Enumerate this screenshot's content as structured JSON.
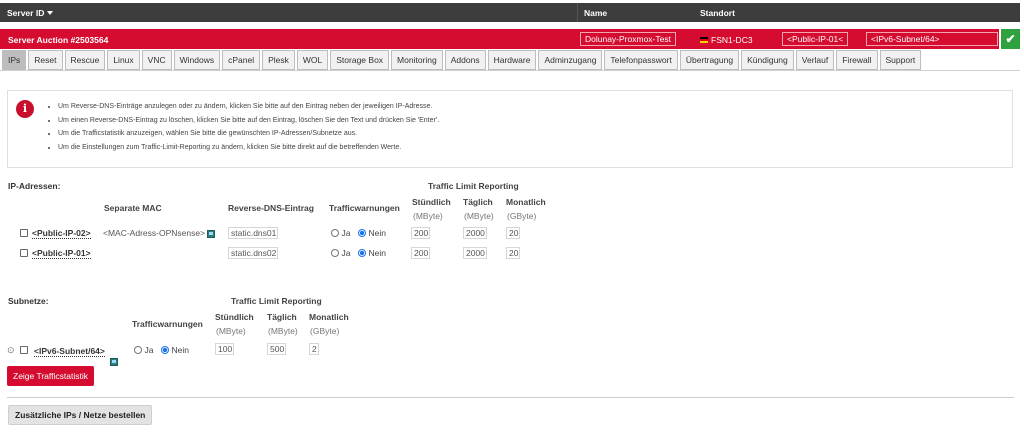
{
  "header": {
    "server_id": "Server ID",
    "name": "Name",
    "standort": "Standort"
  },
  "server": {
    "title": "Server Auction #2503564",
    "name": "Dolunay-Proxmox-Test",
    "location": "FSN1-DC3",
    "public_ip": "<Public-IP-01<",
    "ipv6_subnet": "<IPv6-Subnet/64>",
    "status_icon": "check-icon",
    "flag_icon": "german-flag-icon"
  },
  "tabs": [
    "IPs",
    "Reset",
    "Rescue",
    "Linux",
    "VNC",
    "Windows",
    "cPanel",
    "Plesk",
    "WOL",
    "Storage Box",
    "Monitoring",
    "Addons",
    "Hardware",
    "Adminzugang",
    "Telefonpasswort",
    "Übertragung",
    "Kündigung",
    "Verlauf",
    "Firewall",
    "Support"
  ],
  "info": {
    "icon": "info-icon",
    "items": [
      "Um Reverse-DNS-Einträge anzulegen oder zu ändern, klicken Sie bitte auf den Eintrag neben der jeweiligen IP-Adresse.",
      "Um einen Reverse-DNS-Eintrag zu löschen, klicken Sie bitte auf den Eintrag, löschen Sie den Text und drücken Sie 'Enter'.",
      "Um die Trafficstatistik anzuzeigen, wählen Sie bitte die gewünschten IP-Adressen/Subnetze aus.",
      "Um die Einstellungen zum Traffic-Limit-Reporting zu ändern, klicken Sie bitte direkt auf die betreffenden Werte."
    ]
  },
  "ip_section": {
    "label": "IP-Adressen:",
    "columns": {
      "mac": "Separate MAC",
      "rdns": "Reverse-DNS-Eintrag",
      "warnings": "Trafficwarnungen",
      "tlr": "Traffic Limit Reporting",
      "hourly": "Stündlich",
      "daily": "Täglich",
      "monthly": "Monatlich",
      "unit_mb": "(MByte)",
      "unit_gb": "(GByte)"
    },
    "rows": [
      {
        "ip": "<Public-IP-02>",
        "mac": "<MAC-Adress-OPNsense>",
        "rdns": "static.dns01",
        "ja": "Ja",
        "nein": "Nein",
        "hourly": "200",
        "daily": "2000",
        "monthly": "20"
      },
      {
        "ip": "<Public-IP-01>",
        "mac": "",
        "rdns": "static.dns02",
        "ja": "Ja",
        "nein": "Nein",
        "hourly": "200",
        "daily": "2000",
        "monthly": "20"
      }
    ]
  },
  "subnet_section": {
    "label": "Subnetze:",
    "columns": {
      "warnings": "Trafficwarnungen",
      "tlr": "Traffic Limit Reporting",
      "hourly": "Stündlich",
      "daily": "Täglich",
      "monthly": "Monatlich",
      "unit_mb": "(MByte)",
      "unit_gb": "(GByte)"
    },
    "row": {
      "subnet": "<IPv6-Subnet/64>",
      "ja": "Ja",
      "nein": "Nein",
      "hourly": "100",
      "daily": "500",
      "monthly": "2"
    }
  },
  "buttons": {
    "traffic_stats": "Zeige Trafficstatistik",
    "order_more": "Zusätzliche IPs / Netze bestellen"
  },
  "colors": {
    "accent_red": "#d50c2f",
    "header_dark": "#3d3d3d",
    "ok_green": "#2ea23e"
  }
}
